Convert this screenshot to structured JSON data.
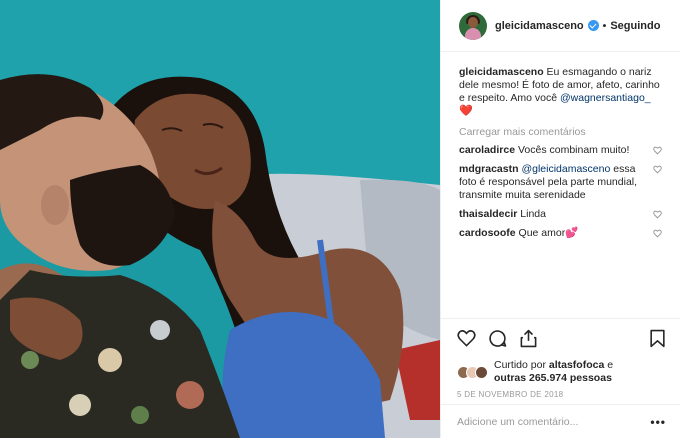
{
  "photo": {
    "description_icon": "couple-photo"
  },
  "header": {
    "username": "gleicidamasceno",
    "separator": "•",
    "follow_status": "Seguindo"
  },
  "caption": {
    "username": "gleicidamasceno",
    "text": " Eu esmagando o nariz dele mesmo! É foto de amor, afeto, carinho e respeito. Amo você ",
    "mention": "@wagnersantiago_",
    "emoji": "❤️"
  },
  "load_more": "Carregar mais comentários",
  "comments": [
    {
      "user": "caroladirce",
      "text": " Vocês combinam muito!",
      "mention": "",
      "text2": ""
    },
    {
      "user": "mdgracastn",
      "text": " ",
      "mention": "@gleicidamasceno",
      "text2": " essa foto é responsável pela parte mundial, transmite muita serenidade"
    },
    {
      "user": "thaisaldecir",
      "text": " Linda",
      "mention": "",
      "text2": ""
    },
    {
      "user": "cardosoofe",
      "text": " Que amor💕",
      "mention": "",
      "text2": ""
    }
  ],
  "likes": {
    "prefix": "Curtido por ",
    "user": "altasfofoca",
    "middle": " e ",
    "others": "outras 265.974 pessoas"
  },
  "date": "5 DE NOVEMBRO DE 2018",
  "add_comment": {
    "placeholder": "Adicione um comentário...",
    "more": "•••"
  },
  "colors": {
    "wall": "#1b9aa3",
    "link": "#003569",
    "verified": "#3897f0",
    "muted": "#999999"
  }
}
